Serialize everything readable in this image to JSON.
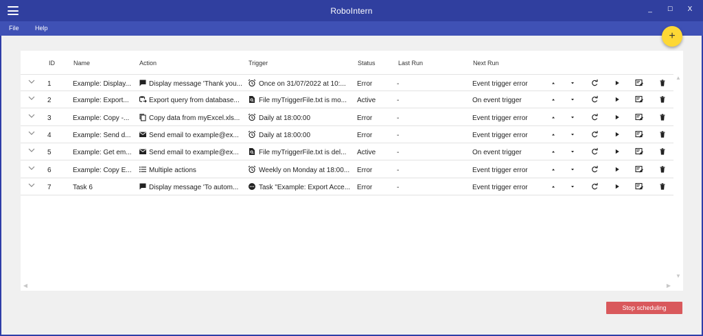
{
  "window": {
    "title": "RoboIntern",
    "minimize": "_",
    "maximize": "☐",
    "close": "X"
  },
  "menu": {
    "file": "File",
    "help": "Help"
  },
  "fab": {
    "label": "+"
  },
  "table": {
    "headers": {
      "id": "ID",
      "name": "Name",
      "action": "Action",
      "trigger": "Trigger",
      "status": "Status",
      "last_run": "Last Run",
      "next_run": "Next Run"
    },
    "rows": [
      {
        "id": "1",
        "name": "Example: Display...",
        "action_icon": "message-icon",
        "action": "Display message 'Thank you...",
        "trigger_icon": "alarm-clock-icon",
        "trigger": "Once on 31/07/2022 at 10:...",
        "status": "Error",
        "last_run": "-",
        "next_run": "Event trigger error"
      },
      {
        "id": "2",
        "name": "Example: Export...",
        "action_icon": "database-export-icon",
        "action": "Export query from database...",
        "trigger_icon": "file-search-icon",
        "trigger": "File myTriggerFile.txt is mo...",
        "status": "Active",
        "last_run": "-",
        "next_run": "On event trigger"
      },
      {
        "id": "3",
        "name": "Example: Copy -...",
        "action_icon": "copy-icon",
        "action": "Copy data from myExcel.xls...",
        "trigger_icon": "alarm-clock-icon",
        "trigger": "Daily at 18:00:00",
        "status": "Error",
        "last_run": "-",
        "next_run": "Event trigger error"
      },
      {
        "id": "4",
        "name": "Example: Send d...",
        "action_icon": "email-icon",
        "action": "Send email to example@ex...",
        "trigger_icon": "alarm-clock-icon",
        "trigger": "Daily at 18:00:00",
        "status": "Error",
        "last_run": "-",
        "next_run": "Event trigger error"
      },
      {
        "id": "5",
        "name": "Example: Get em...",
        "action_icon": "email-icon",
        "action": "Send email to example@ex...",
        "trigger_icon": "file-search-icon",
        "trigger": "File myTriggerFile.txt is del...",
        "status": "Active",
        "last_run": "-",
        "next_run": "On event trigger"
      },
      {
        "id": "6",
        "name": "Example: Copy E...",
        "action_icon": "list-icon",
        "action": "Multiple actions",
        "trigger_icon": "alarm-clock-icon",
        "trigger": "Weekly on Monday at 18:00...",
        "status": "Error",
        "last_run": "-",
        "next_run": "Event trigger error"
      },
      {
        "id": "7",
        "name": "Task 6",
        "action_icon": "message-icon",
        "action": "Display message 'To autom...",
        "trigger_icon": "task-chain-icon",
        "trigger": "Task \"Example: Export Acce...",
        "status": "Error",
        "last_run": "-",
        "next_run": "Event trigger error"
      }
    ]
  },
  "footer": {
    "stop_label": "Stop scheduling"
  },
  "colors": {
    "titlebar": "#303f9f",
    "menubar": "#3f51b5",
    "fab": "#fdd835",
    "stop_button": "#d9595c",
    "background": "#f0f0f0"
  }
}
